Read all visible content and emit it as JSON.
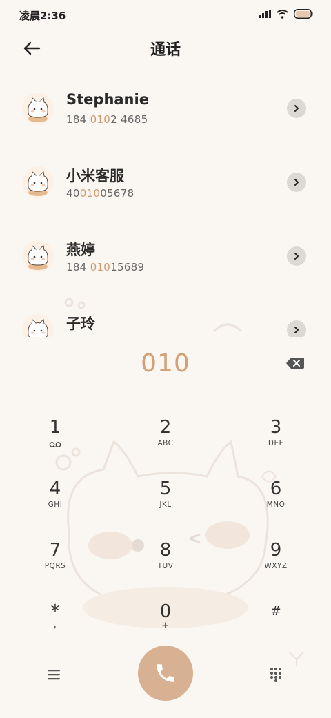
{
  "status_bar": {
    "time": "凌晨2:36",
    "icons": [
      "signal-icon",
      "wifi-icon",
      "battery-icon"
    ]
  },
  "header": {
    "title": "通话",
    "back_icon": "arrow-left-icon"
  },
  "contacts": [
    {
      "name": "Stephanie",
      "number_pre": "184 ",
      "number_hl": "010",
      "number_post": "2 4685"
    },
    {
      "name": "小米客服",
      "number_pre": "40",
      "number_hl": "010",
      "number_post": "05678"
    },
    {
      "name": "燕婷",
      "number_pre": "184 ",
      "number_hl": "010",
      "number_post": "15689"
    },
    {
      "name": "子玲",
      "number_pre": "",
      "number_hl": "",
      "number_post": ""
    }
  ],
  "dial": {
    "number": "010",
    "backspace_icon": "backspace-icon"
  },
  "keypad": [
    {
      "digit": "1",
      "letters": ""
    },
    {
      "digit": "2",
      "letters": "ABC"
    },
    {
      "digit": "3",
      "letters": "DEF"
    },
    {
      "digit": "4",
      "letters": "GHI"
    },
    {
      "digit": "5",
      "letters": "JKL"
    },
    {
      "digit": "6",
      "letters": "MNO"
    },
    {
      "digit": "7",
      "letters": "PQRS"
    },
    {
      "digit": "8",
      "letters": "TUV"
    },
    {
      "digit": "9",
      "letters": "WXYZ"
    },
    {
      "digit": "*",
      "letters": ","
    },
    {
      "digit": "0",
      "letters": "+"
    },
    {
      "digit": "#",
      "letters": ""
    }
  ],
  "bottom_bar": {
    "menu_icon": "menu-icon",
    "call_icon": "phone-icon",
    "dialpad_icon": "dialpad-icon"
  },
  "colors": {
    "accent": "#d4a077",
    "call_button": "#d8b092",
    "background": "#faf6f2"
  }
}
